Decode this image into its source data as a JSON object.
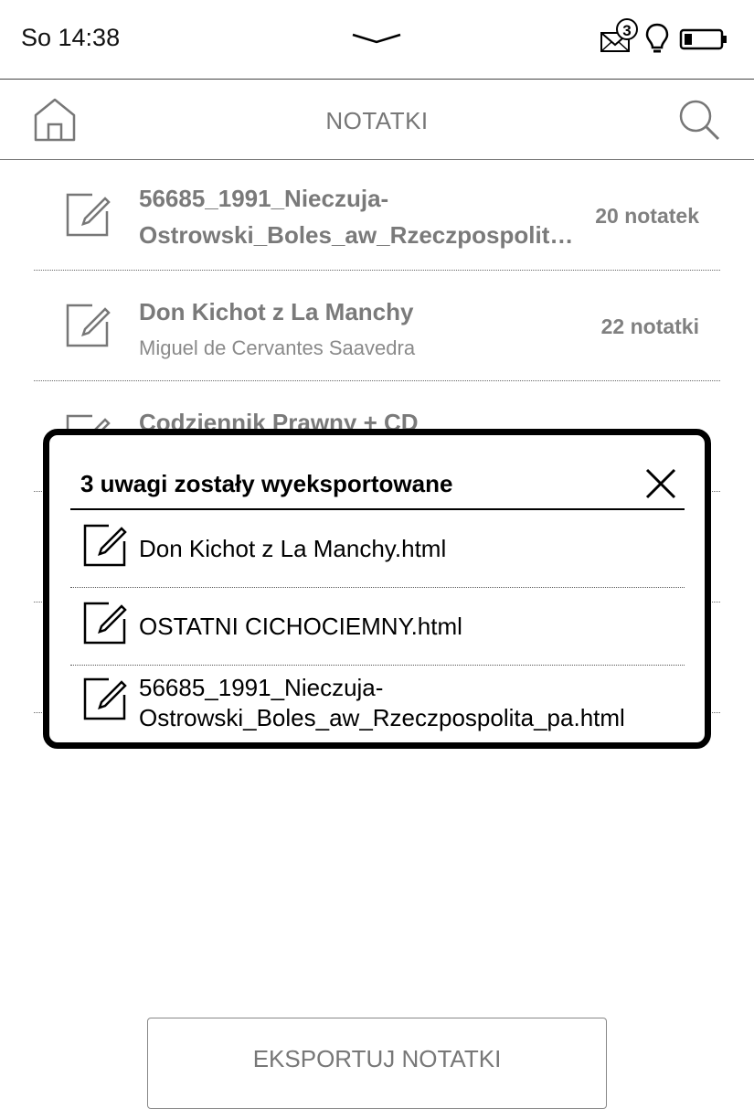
{
  "status": {
    "time": "So 14:38",
    "mail_badge": "3",
    "icons": [
      "chevron-down-icon",
      "mail-icon",
      "bulb-icon",
      "battery-icon"
    ]
  },
  "header": {
    "title": "NOTATKI",
    "icons": [
      "home-icon",
      "search-icon"
    ]
  },
  "notes": [
    {
      "title_line1": "56685_1991_Nieczuja-",
      "title_line2": "Ostrowski_Boles_aw_Rzeczpospolit…",
      "count": "20 notatek"
    },
    {
      "title": "Don Kichot z La Manchy",
      "author": "Miguel de Cervantes Saavedra",
      "count": "22 notatki"
    },
    {
      "title": "Codziennik Prawny + CD"
    }
  ],
  "dialog": {
    "title": "3 uwagi zostały wyeksportowane",
    "files": [
      {
        "line1": "Don Kichot z La Manchy.html"
      },
      {
        "line1": "OSTATNI CICHOCIEMNY.html"
      },
      {
        "line1": "56685_1991_Nieczuja-",
        "line2": "Ostrowski_Boles_aw_Rzeczpospolita_pa.html"
      }
    ]
  },
  "footer": {
    "export_label": "EKSPORTUJ NOTATKI"
  }
}
